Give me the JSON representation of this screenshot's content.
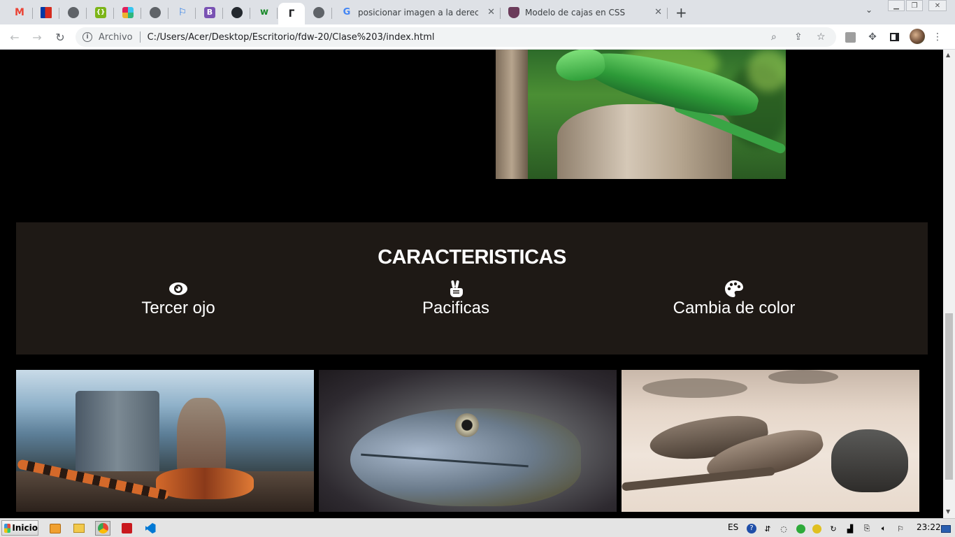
{
  "browser": {
    "pinned_tabs": [
      {
        "icon": "gmail-icon",
        "label": "M",
        "color": "#ea4335"
      },
      {
        "icon": "chile-flag-icon",
        "label": "",
        "color": "#d52b1e"
      },
      {
        "icon": "globe-icon",
        "label": "",
        "color": "#5f6368"
      },
      {
        "icon": "jsfiddle-icon",
        "label": "{}",
        "color": "#7cb518"
      },
      {
        "icon": "slack-icon",
        "label": "",
        "color": "#e01e5a"
      },
      {
        "icon": "globe-icon",
        "label": "",
        "color": "#5f6368"
      },
      {
        "icon": "flag-icon",
        "label": "",
        "color": "#1a73e8"
      },
      {
        "icon": "bootstrap-icon",
        "label": "B",
        "color": "#7952b3"
      },
      {
        "icon": "github-icon",
        "label": "",
        "color": "#24292e"
      },
      {
        "icon": "w-icon",
        "label": "w",
        "color": "#1a8a2a"
      },
      {
        "icon": "dinosaur-icon",
        "label": "",
        "color": "#202124"
      },
      {
        "icon": "globe-icon",
        "label": "",
        "color": "#5f6368"
      }
    ],
    "tabs": [
      {
        "title": "posicionar imagen a la derecha c",
        "icon": "google-icon"
      },
      {
        "title": "Modelo de cajas en CSS",
        "icon": "shield-icon"
      }
    ],
    "address": {
      "scheme_label": "Archivo",
      "url": "C:/Users/Acer/Desktop/Escritorio/fdw-20/Clase%203/index.html"
    }
  },
  "page": {
    "features": {
      "title": "CARACTERISTICAS",
      "items": [
        {
          "label": "Tercer ojo",
          "icon": "eye-icon"
        },
        {
          "label": "Pacificas",
          "icon": "peace-hand-icon"
        },
        {
          "label": "Cambia de color",
          "icon": "palette-icon"
        }
      ]
    },
    "colors": {
      "page_background": "#000000",
      "features_background": "#1e1915",
      "text": "#ffffff"
    }
  },
  "taskbar": {
    "start_label": "Inicio",
    "language": "ES",
    "clock": "23:22"
  }
}
